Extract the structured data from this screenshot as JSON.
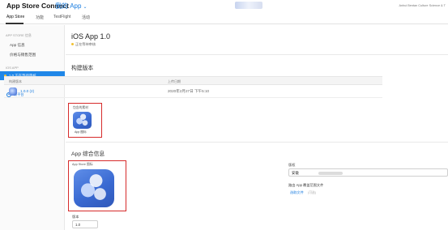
{
  "header": {
    "brand": "App Store Connect",
    "app_menu": "我的 App",
    "account": "Anhui Bentan Culture Science & T"
  },
  "tabs": [
    {
      "label": "App Store"
    },
    {
      "label": "功能"
    },
    {
      "label": "TestFlight"
    },
    {
      "label": "活动"
    }
  ],
  "sidebar": {
    "section_appstore": "APP STORE 信息",
    "items": [
      {
        "label": "App 信息"
      },
      {
        "label": "价格与销售范围"
      }
    ],
    "section_ios": "IOS APP",
    "active_item": "1.0 正在等待审核",
    "add_platform": "新平台"
  },
  "main": {
    "version_title": "iOS App 1.0",
    "status": "正在等待审核",
    "build_section_title": "构建版本",
    "table": {
      "headers": [
        "构建版本",
        "上传日期"
      ],
      "rows": [
        {
          "build": "1.0.0 (2)",
          "date": "2020年2月27日 下午5:10"
        }
      ]
    },
    "included_assets_label": "包含的素材",
    "included_icon_caption": "App 图标",
    "general_section_title": "App 综合信息",
    "store_icon_label": "App Store 图标",
    "version_label": "版本",
    "version_value": "1.0",
    "copyright_label": "版权",
    "copyright_value": "安徽",
    "routing_label": "路由 App 覆盖范围文件",
    "routing_link": "选取文件",
    "routing_hint": "(可选)"
  },
  "colors": {
    "accent": "#1a7de0",
    "sidebar_active": "#1f87e8",
    "status_dot": "#f1c232",
    "highlight": "#d62b2b"
  }
}
